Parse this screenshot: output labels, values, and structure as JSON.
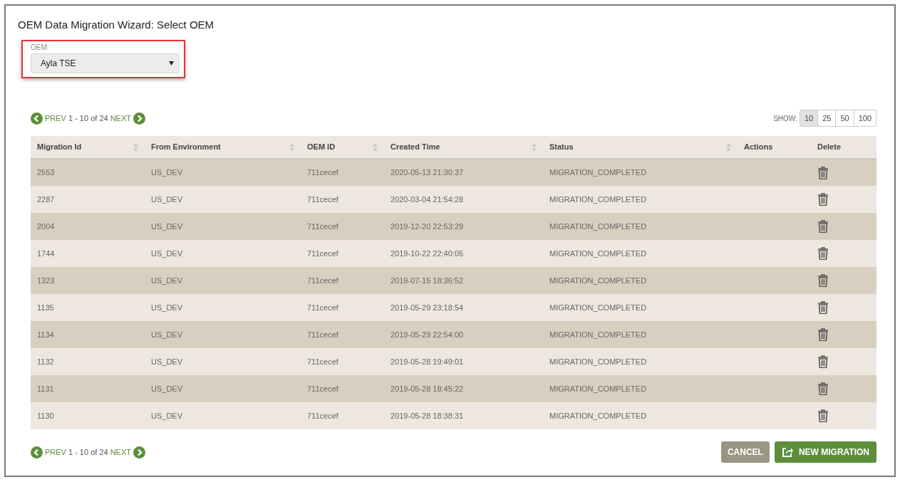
{
  "title": "OEM Data Migration Wizard: Select OEM",
  "oem_field": {
    "label": "OEM:",
    "value": "Ayla TSE",
    "highlighted": true
  },
  "pager_top": {
    "prev": "PREV",
    "range": "1 - 10 of 24",
    "next": "NEXT"
  },
  "page_size": {
    "label": "SHOW:",
    "options": [
      {
        "label": "10",
        "selected": true
      },
      {
        "label": "25",
        "selected": false
      },
      {
        "label": "50",
        "selected": false
      },
      {
        "label": "100",
        "selected": false
      }
    ]
  },
  "table": {
    "columns": [
      {
        "label": "Migration Id",
        "sortable": true
      },
      {
        "label": "From Environment",
        "sortable": true
      },
      {
        "label": "OEM ID",
        "sortable": true
      },
      {
        "label": "Created Time",
        "sortable": true
      },
      {
        "label": "Status",
        "sortable": true
      },
      {
        "label": "Actions",
        "sortable": false
      },
      {
        "label": "Delete",
        "sortable": false
      }
    ],
    "rows": [
      {
        "id": "2553",
        "env": "US_DEV",
        "oem": "711cecef",
        "created": "2020-05-13 21:30:37",
        "status": "MIGRATION_COMPLETED"
      },
      {
        "id": "2287",
        "env": "US_DEV",
        "oem": "711cecef",
        "created": "2020-03-04 21:54:28",
        "status": "MIGRATION_COMPLETED"
      },
      {
        "id": "2004",
        "env": "US_DEV",
        "oem": "711cecef",
        "created": "2019-12-20 22:53:29",
        "status": "MIGRATION_COMPLETED"
      },
      {
        "id": "1744",
        "env": "US_DEV",
        "oem": "711cecef",
        "created": "2019-10-22 22:40:05",
        "status": "MIGRATION_COMPLETED"
      },
      {
        "id": "1323",
        "env": "US_DEV",
        "oem": "711cecef",
        "created": "2019-07-15 18:36:52",
        "status": "MIGRATION_COMPLETED"
      },
      {
        "id": "1135",
        "env": "US_DEV",
        "oem": "711cecef",
        "created": "2019-05-29 23:18:54",
        "status": "MIGRATION_COMPLETED"
      },
      {
        "id": "1134",
        "env": "US_DEV",
        "oem": "711cecef",
        "created": "2019-05-29 22:54:00",
        "status": "MIGRATION_COMPLETED"
      },
      {
        "id": "1132",
        "env": "US_DEV",
        "oem": "711cecef",
        "created": "2019-05-28 19:49:01",
        "status": "MIGRATION_COMPLETED"
      },
      {
        "id": "1131",
        "env": "US_DEV",
        "oem": "711cecef",
        "created": "2019-05-28 18:45:22",
        "status": "MIGRATION_COMPLETED"
      },
      {
        "id": "1130",
        "env": "US_DEV",
        "oem": "711cecef",
        "created": "2019-05-28 18:38:31",
        "status": "MIGRATION_COMPLETED"
      }
    ]
  },
  "pager_bottom": {
    "prev": "PREV",
    "range": "1 - 10 of 24",
    "next": "NEXT"
  },
  "buttons": {
    "cancel": "CANCEL",
    "new_migration": "NEW MIGRATION"
  }
}
